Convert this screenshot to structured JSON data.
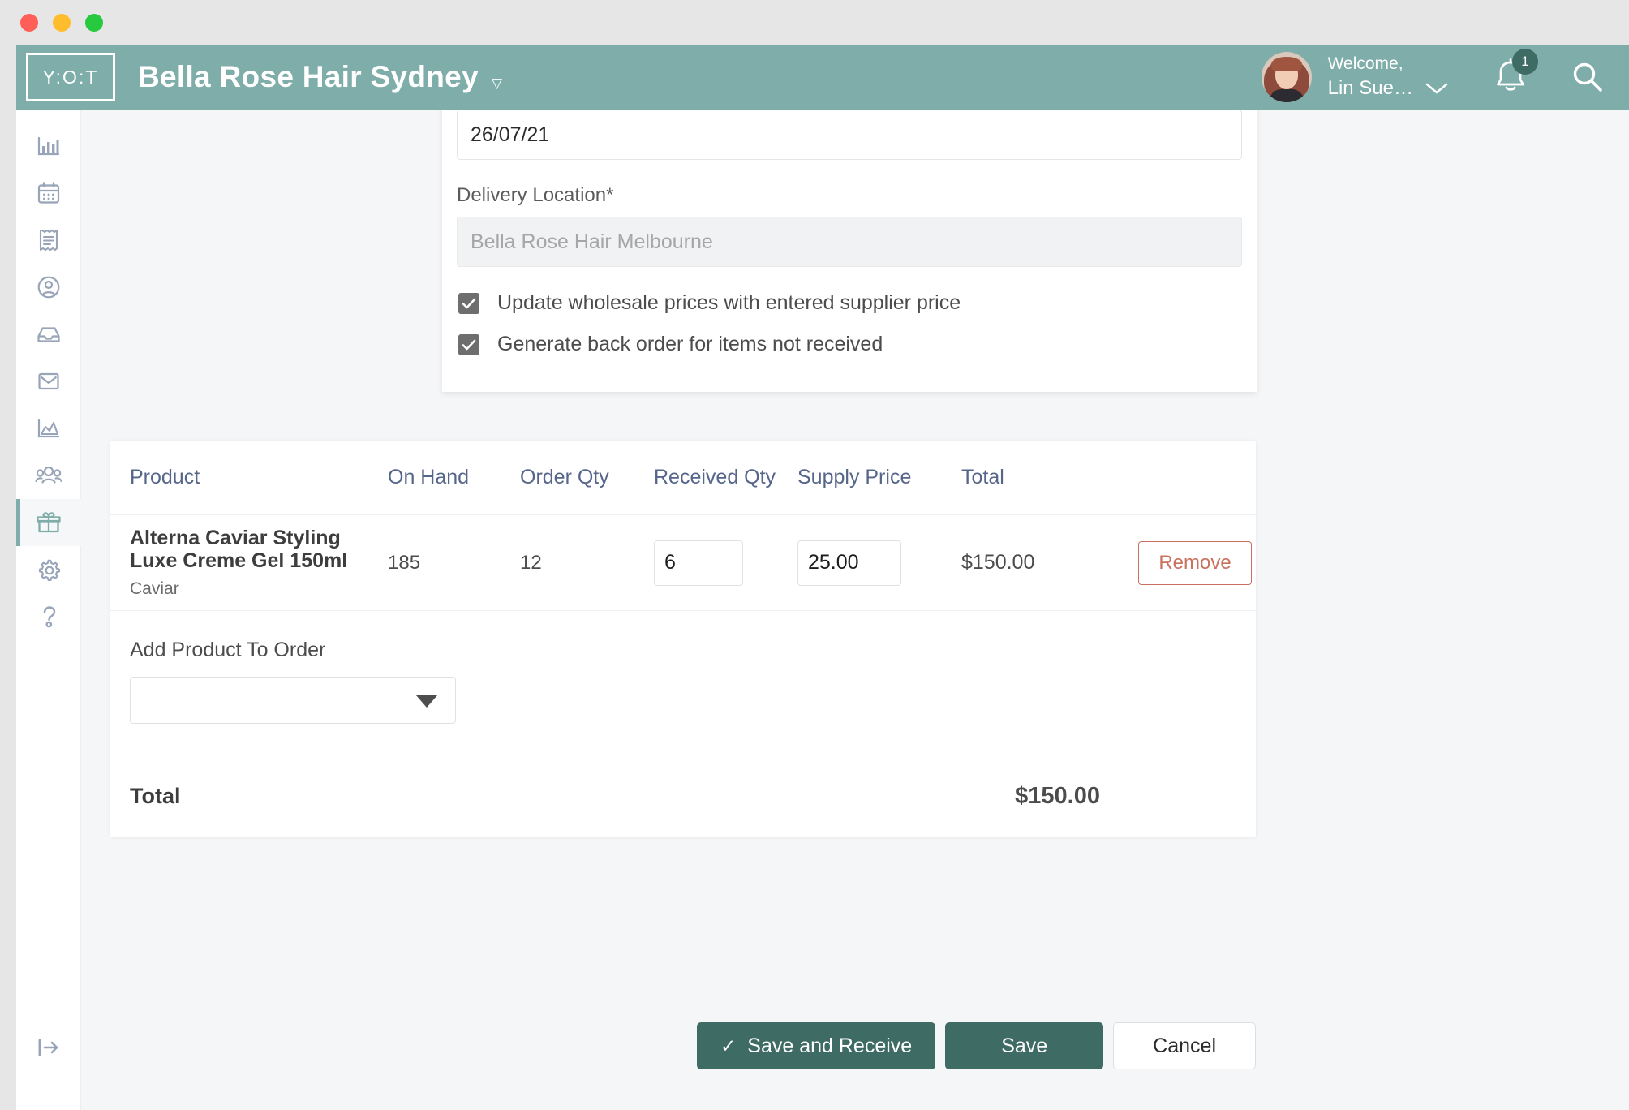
{
  "window": {
    "traffic_lights": [
      "close",
      "minimize",
      "maximize"
    ]
  },
  "topbar": {
    "logo_text": "Y:O:T",
    "brand_title": "Bella Rose Hair Sydney",
    "brand_caret_icon": "caret-down-icon",
    "welcome_line1": "Welcome,",
    "welcome_line2": "Lin Sue…",
    "user_chevron_icon": "chevron-down-icon",
    "notification_count": "1",
    "bell_icon": "bell-icon",
    "search_icon": "search-icon",
    "avatar_alt": "avatar",
    "accent_color": "#7fada9",
    "badge_color": "#3f6b65"
  },
  "sidebar": {
    "items": [
      {
        "icon": "bar-chart-icon",
        "name": "dashboard",
        "active": false
      },
      {
        "icon": "calendar-icon",
        "name": "appointments",
        "active": false
      },
      {
        "icon": "receipt-icon",
        "name": "sales",
        "active": false
      },
      {
        "icon": "user-circle-icon",
        "name": "clients",
        "active": false
      },
      {
        "icon": "inbox-icon",
        "name": "inbox",
        "active": false
      },
      {
        "icon": "envelope-icon",
        "name": "messages",
        "active": false
      },
      {
        "icon": "area-chart-icon",
        "name": "reports",
        "active": false
      },
      {
        "icon": "people-icon",
        "name": "staff",
        "active": false
      },
      {
        "icon": "gift-box-icon",
        "name": "products",
        "active": true
      },
      {
        "icon": "gear-icon",
        "name": "settings",
        "active": false
      },
      {
        "icon": "question-mark-icon",
        "name": "help",
        "active": false
      }
    ],
    "logout_icon": "logout-icon",
    "active_indicator_color": "#7fada9"
  },
  "form": {
    "date_value": "26/07/21",
    "date_placeholder": "",
    "delivery_location_label": "Delivery Location",
    "delivery_location_required": "*",
    "delivery_location_value": "Bella Rose Hair Melbourne",
    "checkboxes": [
      {
        "label": "Update wholesale prices with entered supplier price",
        "checked": true
      },
      {
        "label": "Generate back order for items not received",
        "checked": true
      }
    ]
  },
  "table": {
    "columns": [
      "Product",
      "On Hand",
      "Order Qty",
      "Received Qty",
      "Supply Price",
      "Total"
    ],
    "rows": [
      {
        "product_name": "Alterna Caviar Styling Luxe Creme Gel 150ml",
        "product_brand": "Caviar",
        "on_hand": "185",
        "order_qty": "12",
        "received_qty": "6",
        "supply_price": "25.00",
        "total": "$150.00",
        "remove_label": "Remove"
      }
    ],
    "add_product_label": "Add Product To Order",
    "add_product_value": "",
    "add_product_caret_icon": "caret-down-icon",
    "total_label": "Total",
    "total_value": "$150.00"
  },
  "actions": {
    "save_and_receive_label": "Save and Receive",
    "save_and_receive_icon": "check-icon",
    "save_label": "Save",
    "cancel_label": "Cancel",
    "primary_color": "#3f6b65",
    "remove_color": "#c9715e"
  }
}
